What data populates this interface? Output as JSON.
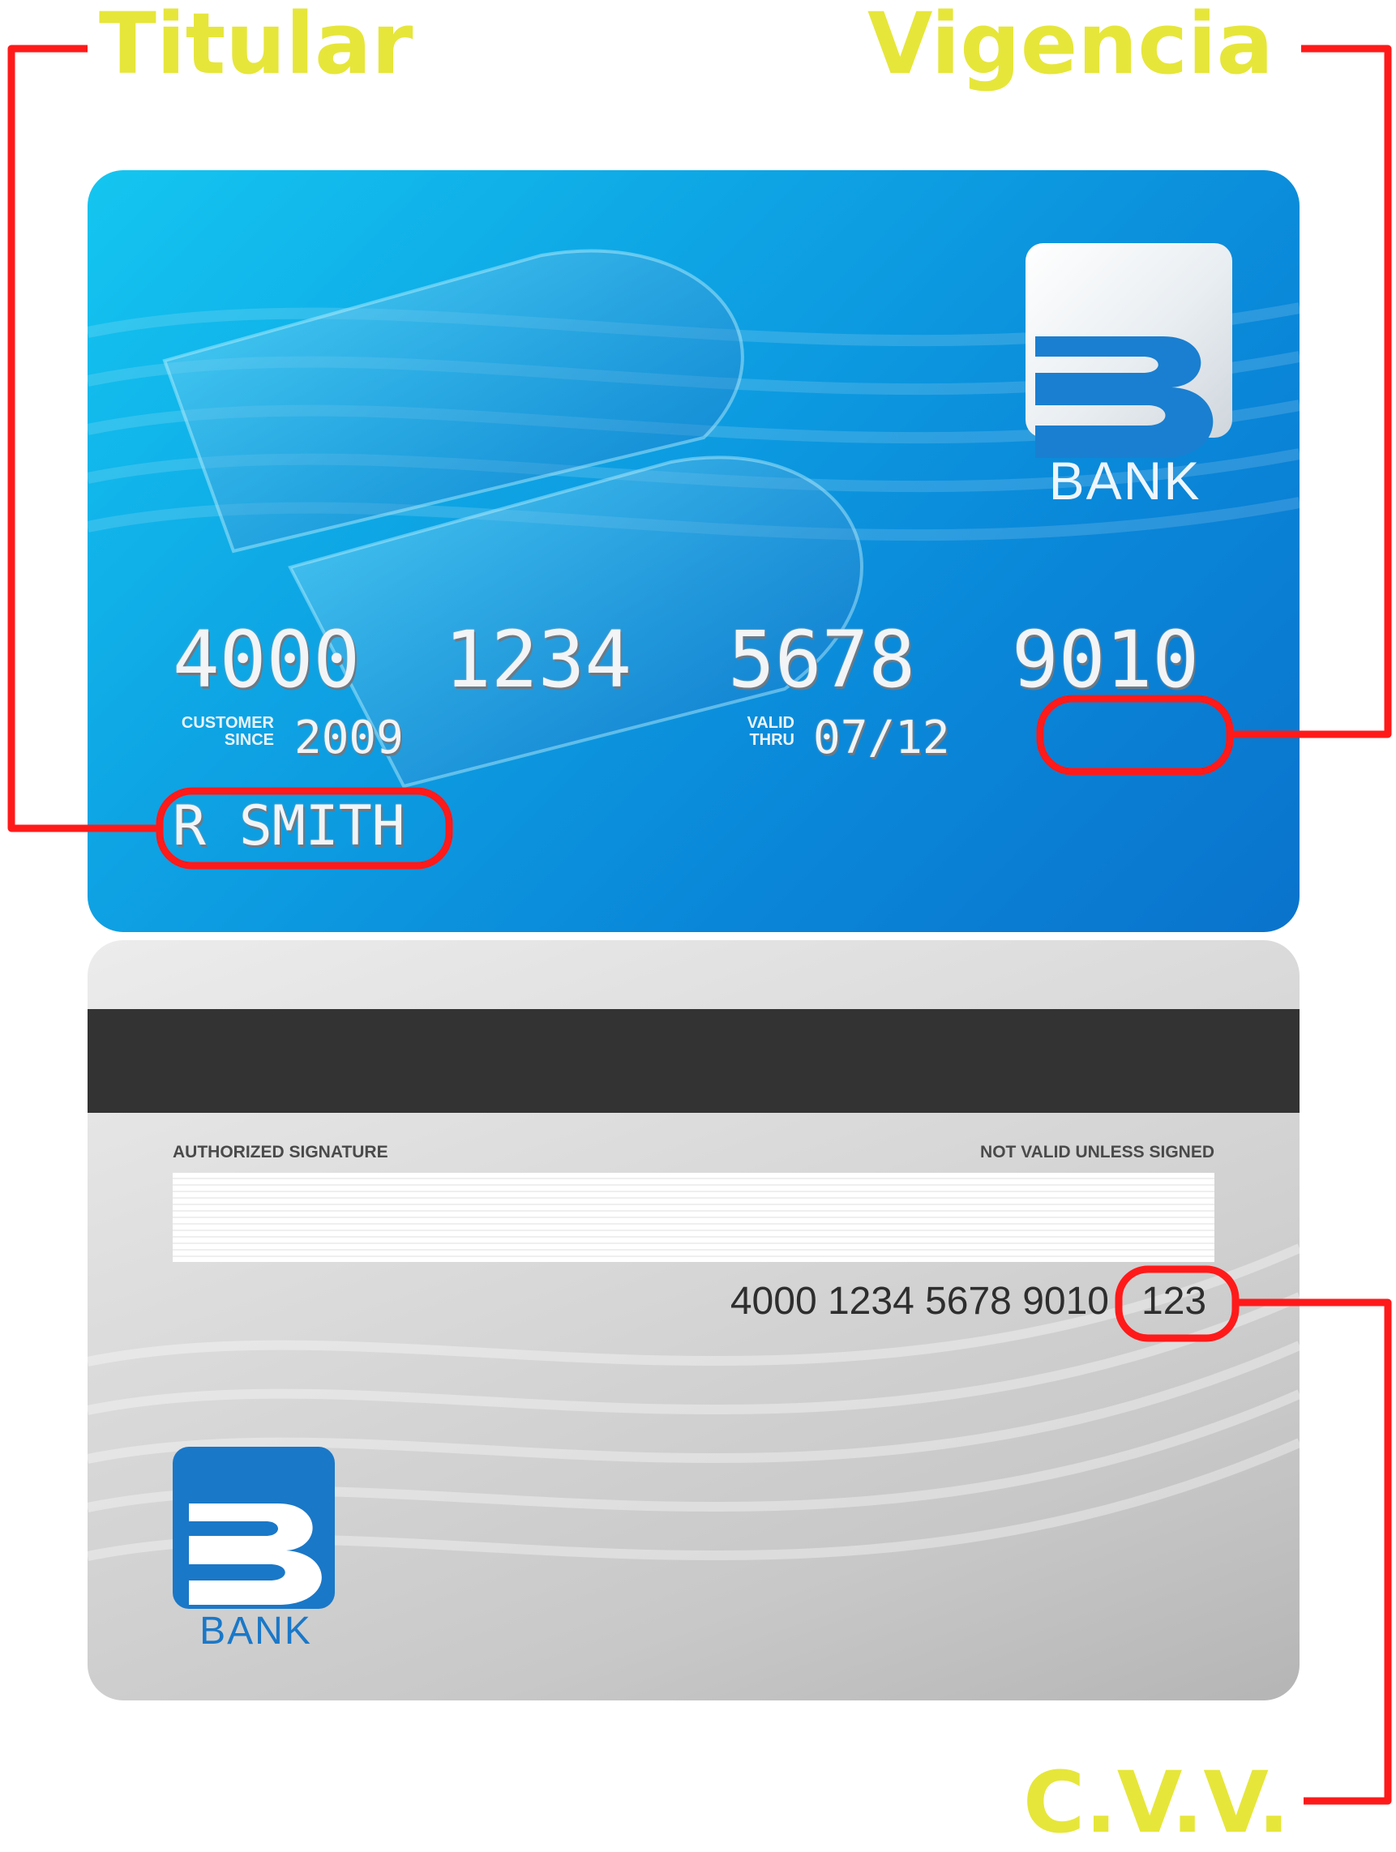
{
  "callouts": {
    "holder": "Titular",
    "validity": "Vigencia",
    "cvv": "C.V.V."
  },
  "front": {
    "card_number": [
      "4000",
      "1234",
      "5678",
      "9010"
    ],
    "customer_since_label_line1": "CUSTOMER",
    "customer_since_label_line2": "SINCE",
    "customer_since_value": "2009",
    "valid_thru_label_line1": "VALID",
    "valid_thru_label_line2": "THRU",
    "valid_thru_value": "07/12",
    "cardholder_name": "R SMITH",
    "bank_name": "BANK"
  },
  "back": {
    "authorized_signature_label": "AUTHORIZED SIGNATURE",
    "not_valid_label": "NOT VALID UNLESS SIGNED",
    "card_number": "4000 1234 5678 9010",
    "cvv": "123",
    "bank_name": "BANK"
  },
  "colors": {
    "callout_text": "#e6e63a",
    "callout_line": "#ff1a1a",
    "front_card": "#0a86d8",
    "brand_blue": "#1a78c8",
    "magnetic_stripe": "#333333"
  }
}
